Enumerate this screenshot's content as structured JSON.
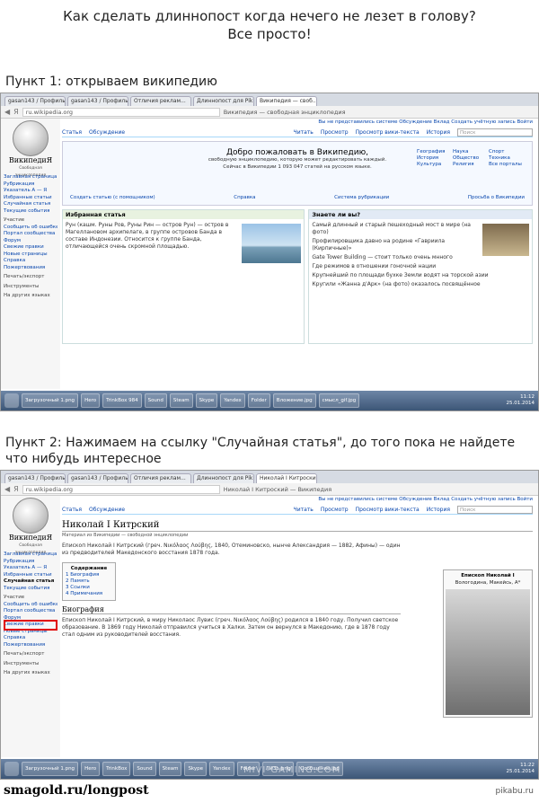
{
  "header": {
    "line1": "Как сделать длиннопост когда нечего не лезет в голову?",
    "line2": "Все просто!"
  },
  "step1": {
    "label": "Пункт 1: открываем википедию",
    "browser": {
      "tabs": [
        "gasan143 / Профиль",
        "gasan143 / Профиль",
        "Отличия реклам...",
        "Длиннопост для Pik...",
        "Википедия — своб..."
      ],
      "url": "ru.wikipedia.org",
      "breadcrumb": "Википедия — свободная энциклопедия"
    },
    "sidebar": {
      "logo_name": "ВикипедиЯ",
      "logo_sub": "Свободная энциклопедия",
      "items": [
        "Заглавная страница",
        "Рубрикация",
        "Указатель А — Я",
        "Избранные статьи",
        "Случайная статья",
        "Текущие события"
      ],
      "group_participation": "Участие",
      "group_items": [
        "Сообщить об ошибке",
        "Портал сообщества",
        "Форум",
        "Свежие правки",
        "Новые страницы",
        "Справка",
        "Пожертвования"
      ],
      "group_print": "Печать/экспорт",
      "group_tools": "Инструменты",
      "group_languages": "На других языках"
    },
    "main": {
      "toplinks": "Вы не представились системе   Обсуждение   Вклад   Создать учётную запись   Войти",
      "tabs_left": [
        "Статья",
        "Обсуждение"
      ],
      "tabs_right": [
        "Читать",
        "Просмотр",
        "Просмотр вики-текста",
        "История"
      ],
      "search_placeholder": "Поиск",
      "welcome_title": "Добро пожаловать в Википедию,",
      "welcome_text": "свободную энциклопедию, которую может редактировать каждый.",
      "welcome_count": "Сейчас в Википедии 1 093 047 статей на русском языке.",
      "portals": [
        "География",
        "Наука",
        "Спорт",
        "История",
        "Общество",
        "Техника",
        "Культура",
        "Религия",
        "Все порталы"
      ],
      "welcome_links": [
        "Создать статью (с помощником)",
        "Справка",
        "Система рубрикации",
        "Просьба о Википедии"
      ],
      "featured_title": "Избранная статья",
      "featured_text": "Рун (кашм. Руны Ров, Руны Рин — остров Рун) — остров в Магеллановом архипелаге, в группе островов Банда в составе Индонезии. Относится к группе Банда, отличающейся очень скромной площадью.",
      "dyk_title": "Знаете ли вы?",
      "dyk_items": [
        "Самый длинный и старый пешеходный мост в мире (на фото)",
        "Профилировщика давно на родине «Гавриила (Кирпичные)»",
        "Gate Tower Building — стоит только очень мнного",
        "Где режимов в отношении гоночной нации",
        "Крупнейший по площади бухке Земли водят на торской азии",
        "Кругили «Жанна д'Арк» (на фото) оказалось посвящённое"
      ]
    },
    "taskbar": {
      "buttons": [
        "Загрузочный 1.png",
        "Hero",
        "TrinkBox 984",
        "Sound",
        "Steam",
        "Skype",
        "Yandex",
        "Folder",
        "Вложение.jpg",
        "смысл_gif.jpg"
      ],
      "time": "11:12",
      "date": "25.01.2014"
    }
  },
  "step2": {
    "label": "Пункт 2: Нажимаем на ссылку \"Случайная статья\", до того пока не найдете что нибудь интересное",
    "browser": {
      "tabs": [
        "gasan143 / Профиль",
        "gasan143 / Профиль",
        "Отличия реклам...",
        "Длиннопост для Pik...",
        "Николай I Китроский"
      ],
      "url": "ru.wikipedia.org",
      "breadcrumb": "Николай I Китроский — Википедия"
    },
    "sidebar": {
      "items": [
        "Заглавная страница",
        "Рубрикация",
        "Указатель А — Я",
        "Избранные статьи",
        "Случайная статья",
        "Текущие события"
      ],
      "group_participation": "Участие",
      "group_items": [
        "Сообщить об ошибке",
        "Портал сообщества",
        "Форум",
        "Свежие правки",
        "Новые страницы",
        "Справка",
        "Пожертвования"
      ],
      "group_print": "Печать/экспорт",
      "group_tools": "Инструменты",
      "group_languages": "На других языках"
    },
    "article": {
      "title": "Николай I Китрский",
      "subtitle": "Материал из Википедии — свободной энциклопедии",
      "intro": "Епископ Николай I Китрский (греч. Νικόλαος Λούβης, 1840, Отеминовско, нынче Александрия — 1882, Афины) — один из предводителей Македонского восстания 1878 года.",
      "toc_title": "Содержание",
      "toc_items": [
        "1 Биография",
        "2 Память",
        "3 Ссылки",
        "4 Примечания"
      ],
      "section": "Биография",
      "section_text": "Епископ Николай I Китрский, в миру Николаос Лувис (греч. Νικόλαος Λούβης) родился в 1840 году. Получил светское образование. В 1869 году Николай отправился учиться в Халки. Затем он вернулся в Македонию, где в 1878 году стал одним из руководителей восстания.",
      "infobox_title": "Епископ Николай I",
      "infobox_sub": "Вологодина, Макейсь, А*"
    },
    "taskbar": {
      "buttons": [
        "Загрузочный 1.png",
        "Hero",
        "TrinkBox",
        "Sound",
        "Steam",
        "Skype",
        "Yandex",
        "Folder",
        "ЛИЗЬ.png",
        "Сообщение.jpg"
      ],
      "time": "11:22",
      "date": "25.01.2014",
      "watermark": "MIVI-GAMING.COM"
    }
  },
  "footer": {
    "source": "smagold.ru/longpost",
    "site": "pikabu.ru"
  },
  "colors": {
    "link": "#0645ad",
    "highlight": "#e00000",
    "taskbar": "#3d5677"
  }
}
